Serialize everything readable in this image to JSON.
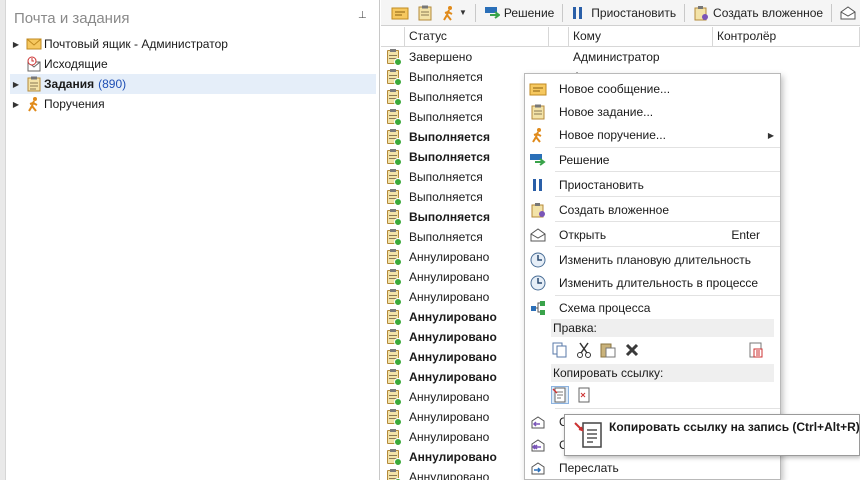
{
  "left_pane": {
    "title": "Почта и задания",
    "pin_glyph": "⊥",
    "tree": [
      {
        "label": "Почтовый ящик - Администратор",
        "icon": "mailbox-icon",
        "expandable": true,
        "bold": false,
        "count": ""
      },
      {
        "label": "Исходящие",
        "icon": "outbox-icon",
        "expandable": false,
        "bold": false,
        "count": ""
      },
      {
        "label": "Задания",
        "icon": "tasks-icon",
        "expandable": true,
        "bold": true,
        "count": "(890)",
        "selected": true
      },
      {
        "label": "Поручения",
        "icon": "assignment-icon",
        "expandable": true,
        "bold": false,
        "count": ""
      }
    ]
  },
  "toolbar": {
    "decision_label": "Решение",
    "pause_label": "Приостановить",
    "create_nested_label": "Создать вложенное"
  },
  "grid": {
    "headers": {
      "status": "Статус",
      "to": "Кому",
      "controller": "Контролёр"
    },
    "rows": [
      {
        "status": "Завершено",
        "bold": false,
        "to": "Администратор"
      },
      {
        "status": "Выполняется",
        "bold": false,
        "to": "А"
      },
      {
        "status": "Выполняется",
        "bold": false,
        "to": ""
      },
      {
        "status": "Выполняется",
        "bold": false,
        "to": ""
      },
      {
        "status": "Выполняется",
        "bold": true,
        "to": ""
      },
      {
        "status": "Выполняется",
        "bold": true,
        "to": ""
      },
      {
        "status": "Выполняется",
        "bold": false,
        "to": ""
      },
      {
        "status": "Выполняется",
        "bold": false,
        "to": ""
      },
      {
        "status": "Выполняется",
        "bold": true,
        "to": ""
      },
      {
        "status": "Выполняется",
        "bold": false,
        "to": ""
      },
      {
        "status": "Аннулировано",
        "bold": false,
        "to": ""
      },
      {
        "status": "Аннулировано",
        "bold": false,
        "to": ""
      },
      {
        "status": "Аннулировано",
        "bold": false,
        "to": ""
      },
      {
        "status": "Аннулировано",
        "bold": true,
        "to": ""
      },
      {
        "status": "Аннулировано",
        "bold": true,
        "to": ""
      },
      {
        "status": "Аннулировано",
        "bold": true,
        "to": ""
      },
      {
        "status": "Аннулировано",
        "bold": true,
        "to": ""
      },
      {
        "status": "Аннулировано",
        "bold": false,
        "to": ""
      },
      {
        "status": "Аннулировано",
        "bold": false,
        "to": ""
      },
      {
        "status": "Аннулировано",
        "bold": false,
        "to": ""
      },
      {
        "status": "Аннулировано",
        "bold": true,
        "to": ""
      },
      {
        "status": "Аннулировано",
        "bold": false,
        "to": ""
      }
    ]
  },
  "context_menu": {
    "new_message": "Новое сообщение...",
    "new_task": "Новое задание...",
    "new_assignment": "Новое поручение...",
    "decision": "Решение",
    "pause": "Приостановить",
    "create_nested": "Создать вложенное",
    "open": "Открыть",
    "open_shortcut": "Enter",
    "change_planned_duration": "Изменить плановую длительность",
    "change_duration_in_process": "Изменить длительность в процессе",
    "process_scheme": "Схема процесса",
    "edit_section": "Правка:",
    "copy_link_section": "Копировать ссылку:",
    "partial_1": "С",
    "partial_2": "С",
    "forward": "Переслать"
  },
  "tooltip": {
    "text": "Копировать ссылку на запись (Ctrl+Alt+R)"
  },
  "colors": {
    "accent_blue": "#1f4fb5",
    "selection": "#e5eef9",
    "ok_green": "#3aa93a",
    "delete_dark": "#3a3a3a"
  }
}
